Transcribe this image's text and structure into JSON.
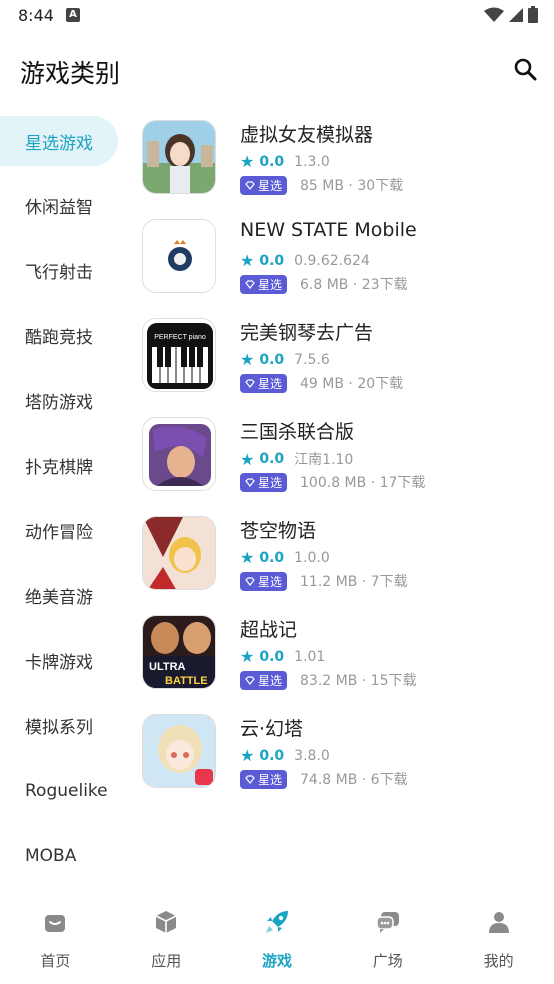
{
  "status": {
    "time": "8:44",
    "notif": "A"
  },
  "header": {
    "title": "游戏类别"
  },
  "sidebar": {
    "items": [
      {
        "label": "星选游戏"
      },
      {
        "label": "休闲益智"
      },
      {
        "label": "飞行射击"
      },
      {
        "label": "酷跑竞技"
      },
      {
        "label": "塔防游戏"
      },
      {
        "label": "扑克棋牌"
      },
      {
        "label": "动作冒险"
      },
      {
        "label": "绝美音游"
      },
      {
        "label": "卡牌游戏"
      },
      {
        "label": "模拟系列"
      },
      {
        "label": "Roguelike"
      },
      {
        "label": "MOBA"
      }
    ]
  },
  "games": [
    {
      "name": "虚拟女友模拟器",
      "score": "0.0",
      "version": "1.3.0",
      "badge": "星选",
      "meta": "85 MB · 30下载"
    },
    {
      "name": "NEW STATE Mobile",
      "score": "0.0",
      "version": "0.9.62.624",
      "badge": "星选",
      "meta": "6.8 MB · 23下载"
    },
    {
      "name": "完美钢琴去广告",
      "score": "0.0",
      "version": "7.5.6",
      "badge": "星选",
      "meta": "49 MB · 20下载"
    },
    {
      "name": "三国杀联合版",
      "score": "0.0",
      "version": "江南1.10",
      "badge": "星选",
      "meta": "100.8 MB · 17下载"
    },
    {
      "name": "苍空物语",
      "score": "0.0",
      "version": "1.0.0",
      "badge": "星选",
      "meta": "11.2 MB · 7下载"
    },
    {
      "name": "超战记",
      "score": "0.0",
      "version": "1.01",
      "badge": "星选",
      "meta": "83.2 MB · 15下载"
    },
    {
      "name": "云·幻塔",
      "score": "0.0",
      "version": "3.8.0",
      "badge": "星选",
      "meta": "74.8 MB · 6下载"
    }
  ],
  "icon_texts": {
    "piano_brand": "PERFECT piano",
    "ultra": "ULTRA",
    "battle": "BATTLE"
  },
  "nav": {
    "items": [
      {
        "label": "首页",
        "icon": "home-bag-icon"
      },
      {
        "label": "应用",
        "icon": "cube-icon"
      },
      {
        "label": "游戏",
        "icon": "rocket-icon"
      },
      {
        "label": "广场",
        "icon": "chat-bubbles-icon"
      },
      {
        "label": "我的",
        "icon": "person-icon"
      }
    ]
  },
  "colors": {
    "accent": "#1aa3c2",
    "badge": "#5c5bd6",
    "active_bg": "#e2f4f7"
  }
}
